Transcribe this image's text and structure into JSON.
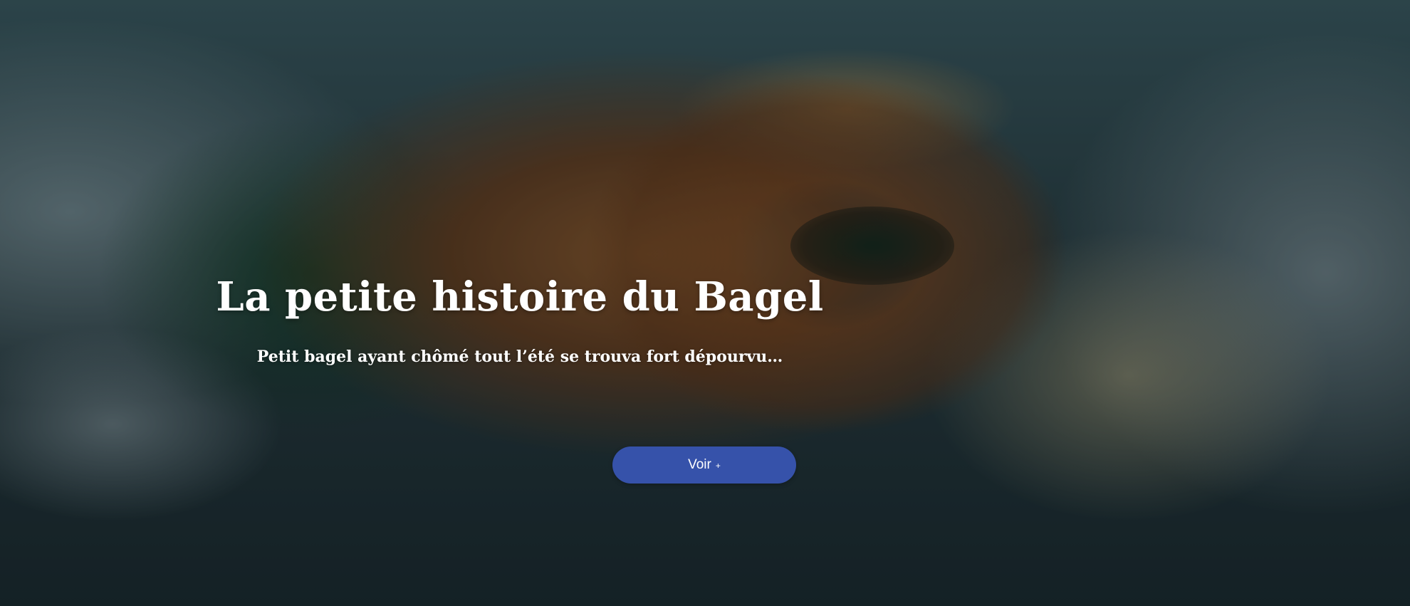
{
  "hero": {
    "title": "La petite histoire du Bagel",
    "subtitle": "Petit bagel ayant chômé tout l’été se trouva fort dépourvu…",
    "button_label": "Voir",
    "button_icon": "plus-icon",
    "button_icon_glyph": "+",
    "button_color": "#3652aa",
    "text_color": "#ffffff"
  }
}
